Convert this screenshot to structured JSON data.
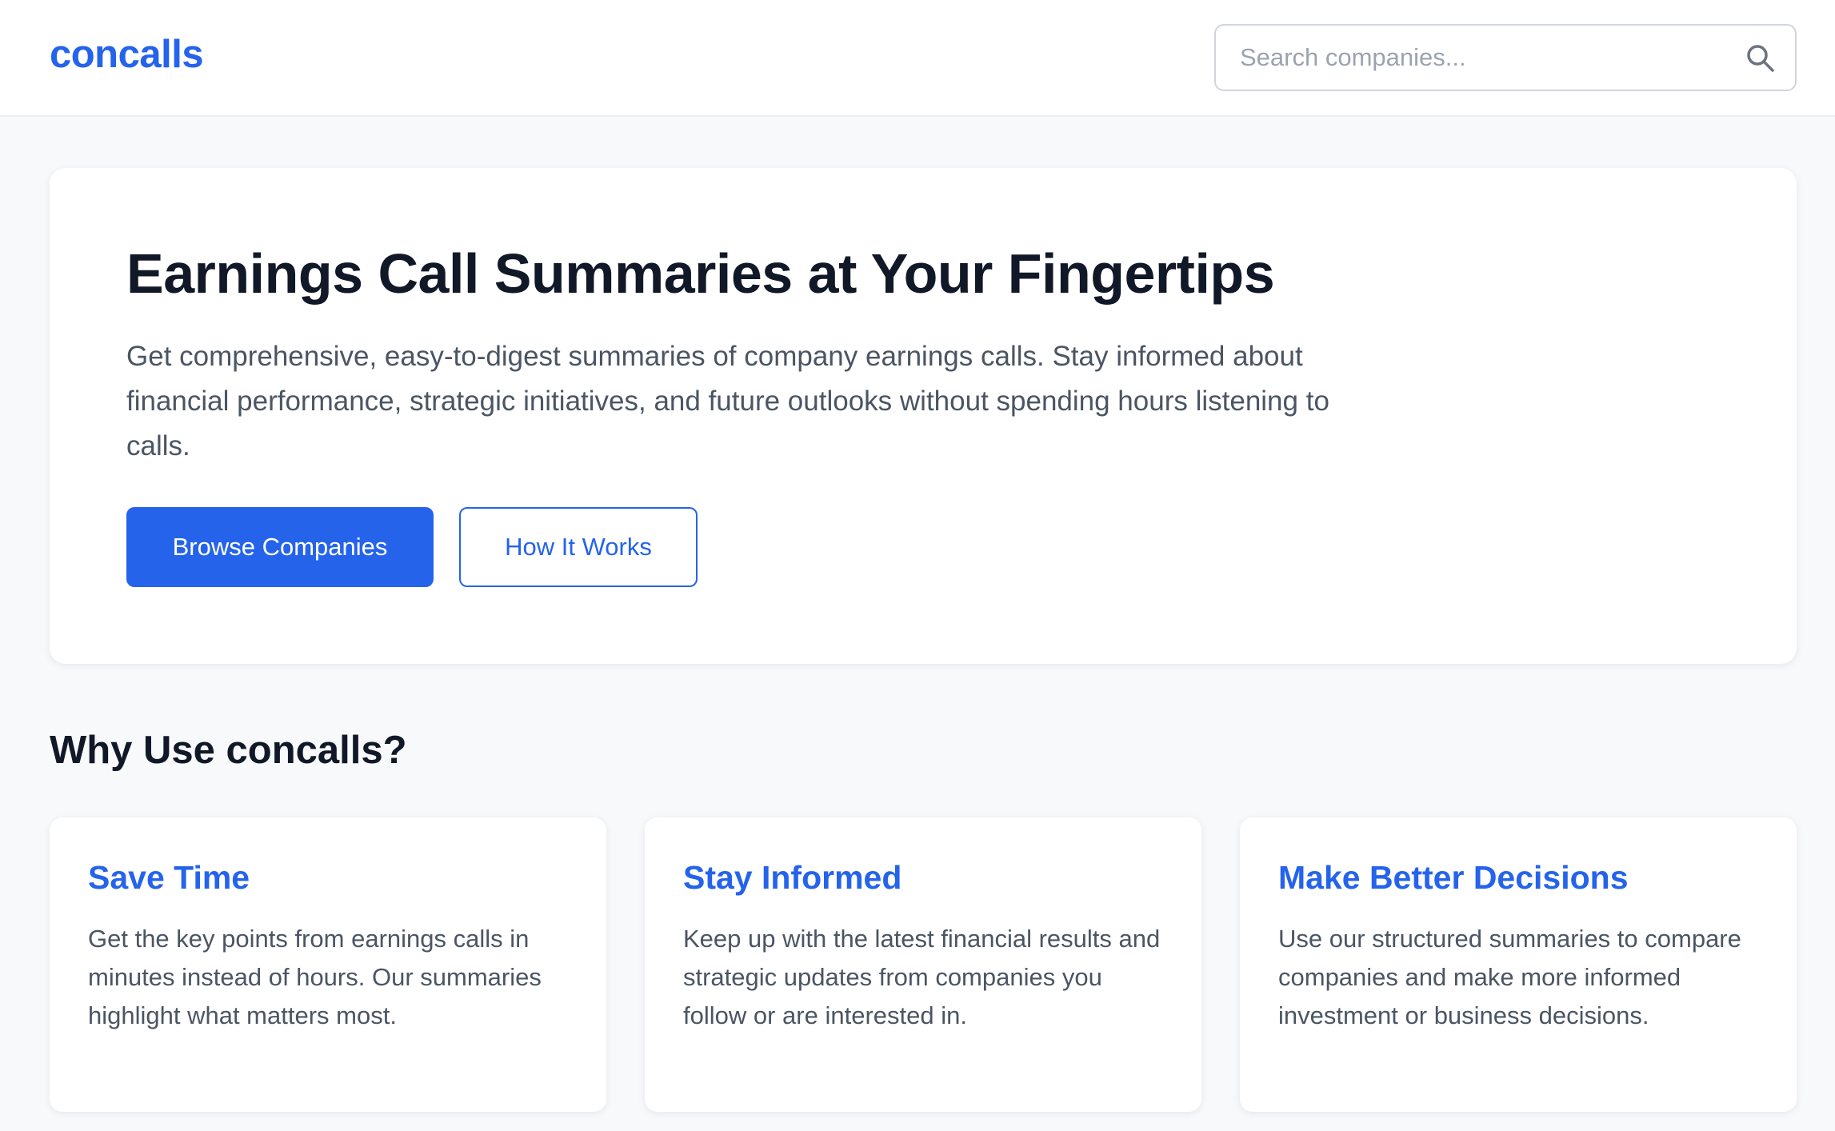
{
  "header": {
    "logo": "concalls",
    "search_placeholder": "Search companies..."
  },
  "hero": {
    "title": "Earnings Call Summaries at Your Fingertips",
    "description": "Get comprehensive, easy-to-digest summaries of company earnings calls. Stay informed about financial performance, strategic initiatives, and future outlooks without spending hours listening to calls.",
    "primary_button": "Browse Companies",
    "secondary_button": "How It Works"
  },
  "features": {
    "title": "Why Use concalls?",
    "cards": [
      {
        "title": "Save Time",
        "text": "Get the key points from earnings calls in minutes instead of hours. Our summaries highlight what matters most."
      },
      {
        "title": "Stay Informed",
        "text": "Keep up with the latest financial results and strategic updates from companies you follow or are interested in."
      },
      {
        "title": "Make Better Decisions",
        "text": "Use our structured summaries to compare companies and make more informed investment or business decisions."
      }
    ]
  },
  "icons": {
    "search": "search-icon"
  },
  "colors": {
    "accent": "#2563eb",
    "page_background": "#f8f9fb",
    "heading": "#111827",
    "body_text": "#4b5563"
  }
}
